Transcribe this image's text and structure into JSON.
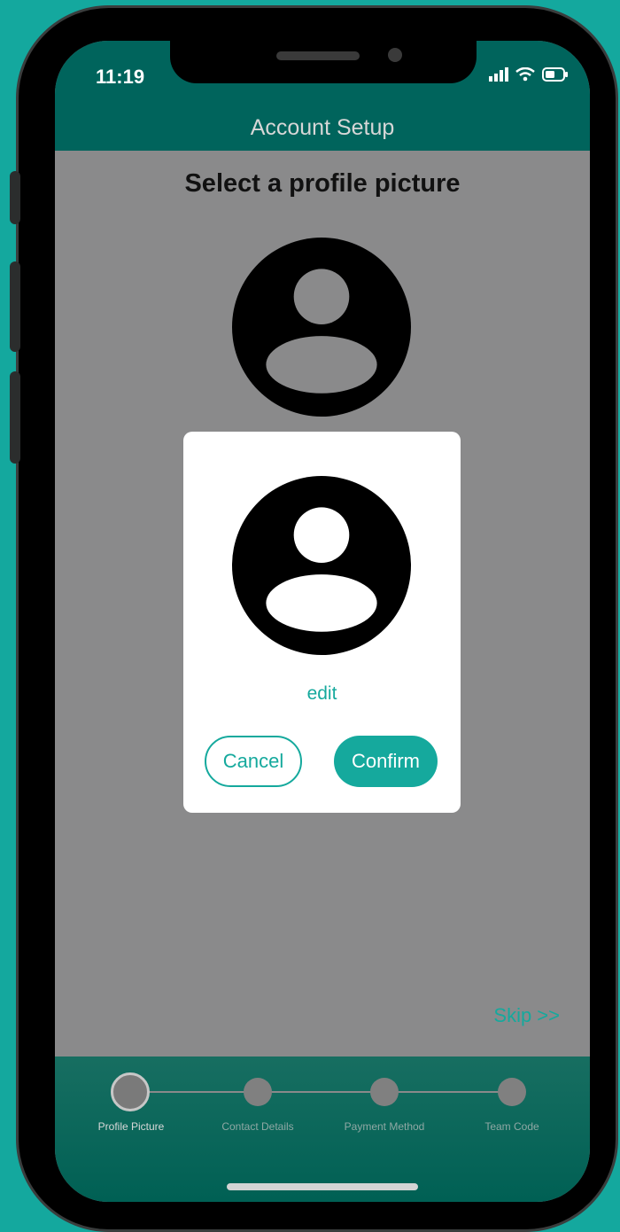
{
  "status_bar": {
    "time": "11:19"
  },
  "header": {
    "title": "Account Setup"
  },
  "main": {
    "heading": "Select a profile picture"
  },
  "modal": {
    "edit_label": "edit",
    "cancel_label": "Cancel",
    "confirm_label": "Confirm"
  },
  "skip_label": "Skip >>",
  "steps": [
    {
      "label": "Profile Picture",
      "active": true
    },
    {
      "label": "Contact Details",
      "active": false
    },
    {
      "label": "Payment Method",
      "active": false
    },
    {
      "label": "Team Code",
      "active": false
    }
  ],
  "colors": {
    "background": "#14a89e",
    "header": "#00645c",
    "accent": "#15a99d",
    "overlay": "#8a8a8b"
  }
}
